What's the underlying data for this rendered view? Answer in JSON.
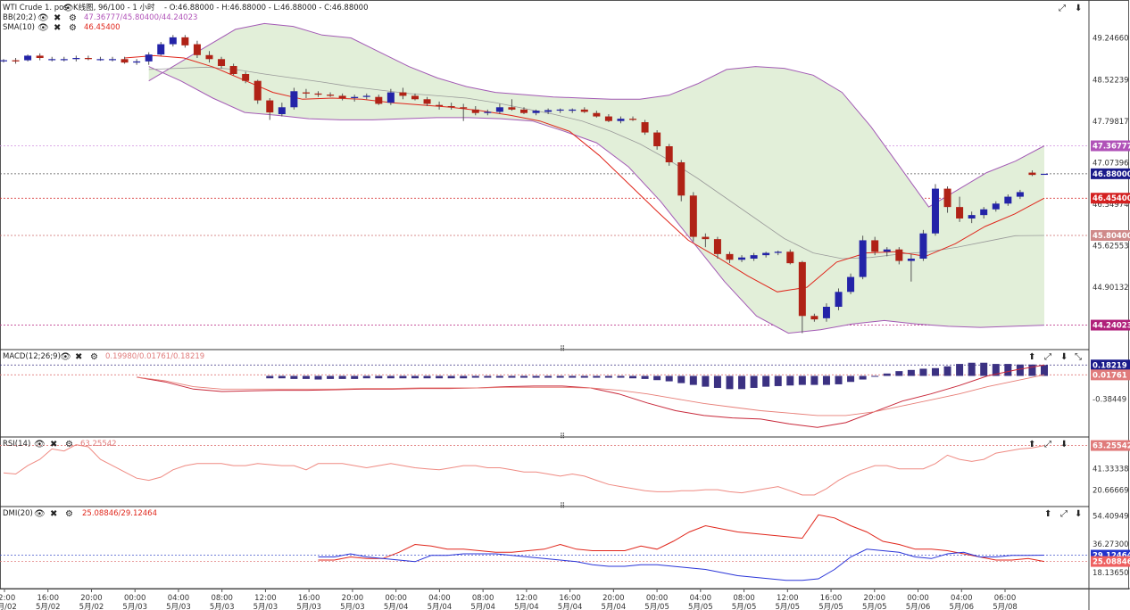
{
  "header": {
    "symbol": "WTI Crude 1. pos",
    "period": "K线图, 96/100 - 1 小时",
    "ohlc": "- O:46.88000 - H:46.88000 - L:46.88000 - C:46.88000"
  },
  "colors": {
    "up": "#2323a8",
    "down": "#b02216",
    "band_fill": "#e2efd9",
    "band_line": "#a35ab5",
    "mid_line": "#9a9a9a",
    "sma_line": "#e0261b",
    "macd_bar": "#3b3182",
    "macd_line": "#c8283a",
    "signal_line": "#e77d76",
    "rsi_line": "#ef8a82",
    "dmi_plus": "#e0261b",
    "dmi_minus": "#2a35d8",
    "tag_bb_upper": "#b052b8",
    "tag_last": "#1a1a8a",
    "tag_sma": "#d42020",
    "tag_bb_mid": "#cf8a8a",
    "tag_bb_lower": "#b0207a",
    "tag_macd": "#1a1a8a",
    "tag_signal": "#e07b7b",
    "tag_rsi": "#e07b7b",
    "tag_dmi_plus": "#ee6060",
    "tag_dmi_minus": "#2233cc"
  },
  "indicators": {
    "bb": {
      "name": "BB(20;2)",
      "value": "47.36777/45.80400/44.24023"
    },
    "sma": {
      "name": "SMA(10)",
      "value": "46.45400"
    },
    "macd": {
      "name": "MACD(12;26;9)",
      "value": "0.19980/0.01761/0.18219"
    },
    "rsi": {
      "name": "RSI(14)",
      "value": "63.25542"
    },
    "dmi": {
      "name": "DMI(20)",
      "value": "25.08846/29.12464"
    }
  },
  "price_axis": {
    "ticks": [
      "49.24660",
      "48.52239",
      "47.79817",
      "47.07396",
      "46.34974",
      "45.62553",
      "44.90132"
    ],
    "tags": {
      "bb_upper": "47.36777",
      "last": "46.88000",
      "sma": "46.45400",
      "bb_mid": "45.80400",
      "bb_lower": "44.24023"
    }
  },
  "macd_axis": {
    "ticks": [
      "-0.38449"
    ],
    "tags": {
      "macd": "0.18219",
      "signal": "0.01761"
    }
  },
  "rsi_axis": {
    "ticks": [
      "41.33338",
      "20.66669"
    ],
    "tags": {
      "rsi": "63.25542"
    }
  },
  "dmi_axis": {
    "ticks": [
      "54.40949",
      "36.27300",
      "18.13650"
    ],
    "tags": {
      "plus": "25.08846",
      "minus": "29.12464"
    }
  },
  "time_axis": [
    [
      "12:00",
      "5月/02"
    ],
    [
      "16:00",
      "5月/02"
    ],
    [
      "20:00",
      "5月/02"
    ],
    [
      "00:00",
      "5月/03"
    ],
    [
      "04:00",
      "5月/03"
    ],
    [
      "08:00",
      "5月/03"
    ],
    [
      "12:00",
      "5月/03"
    ],
    [
      "16:00",
      "5月/03"
    ],
    [
      "20:00",
      "5月/03"
    ],
    [
      "00:00",
      "5月/04"
    ],
    [
      "04:00",
      "5月/04"
    ],
    [
      "08:00",
      "5月/04"
    ],
    [
      "12:00",
      "5月/04"
    ],
    [
      "16:00",
      "5月/04"
    ],
    [
      "20:00",
      "5月/04"
    ],
    [
      "00:00",
      "5月/05"
    ],
    [
      "04:00",
      "5月/05"
    ],
    [
      "08:00",
      "5月/05"
    ],
    [
      "12:00",
      "5月/05"
    ],
    [
      "16:00",
      "5月/05"
    ],
    [
      "20:00",
      "5月/05"
    ],
    [
      "00:00",
      "5月/06"
    ],
    [
      "04:00",
      "5月/06"
    ],
    [
      "06:00",
      "5月/08"
    ]
  ],
  "chart_data": {
    "type": "candlestick",
    "title": "WTI Crude 1. pos",
    "interval": "1 hour",
    "ylim": [
      44.0,
      49.6
    ],
    "candles": [
      [
        48.85,
        48.88,
        48.82,
        48.86
      ],
      [
        48.86,
        48.9,
        48.8,
        48.84
      ],
      [
        48.86,
        48.96,
        48.84,
        48.94
      ],
      [
        48.94,
        48.98,
        48.86,
        48.9
      ],
      [
        48.88,
        48.92,
        48.84,
        48.88
      ],
      [
        48.88,
        48.92,
        48.84,
        48.88
      ],
      [
        48.88,
        48.94,
        48.84,
        48.9
      ],
      [
        48.9,
        48.94,
        48.86,
        48.88
      ],
      [
        48.88,
        48.92,
        48.85,
        48.88
      ],
      [
        48.88,
        48.92,
        48.84,
        48.88
      ],
      [
        48.88,
        48.92,
        48.8,
        48.82
      ],
      [
        48.82,
        48.88,
        48.78,
        48.84
      ],
      [
        48.84,
        49.0,
        48.78,
        48.96
      ],
      [
        48.96,
        49.18,
        48.94,
        49.14
      ],
      [
        49.14,
        49.3,
        49.1,
        49.26
      ],
      [
        49.26,
        49.3,
        49.08,
        49.12
      ],
      [
        49.14,
        49.2,
        48.9,
        48.95
      ],
      [
        48.95,
        49.02,
        48.82,
        48.88
      ],
      [
        48.88,
        48.92,
        48.72,
        48.76
      ],
      [
        48.76,
        48.8,
        48.6,
        48.62
      ],
      [
        48.62,
        48.66,
        48.46,
        48.5
      ],
      [
        48.5,
        48.52,
        48.1,
        48.16
      ],
      [
        48.16,
        48.2,
        47.82,
        47.95
      ],
      [
        47.92,
        48.12,
        47.88,
        48.04
      ],
      [
        48.04,
        48.38,
        48.0,
        48.32
      ],
      [
        48.3,
        48.36,
        48.2,
        48.28
      ],
      [
        48.28,
        48.32,
        48.22,
        48.26
      ],
      [
        48.26,
        48.3,
        48.22,
        48.24
      ],
      [
        48.24,
        48.28,
        48.16,
        48.2
      ],
      [
        48.2,
        48.26,
        48.14,
        48.22
      ],
      [
        48.22,
        48.28,
        48.18,
        48.24
      ],
      [
        48.22,
        48.26,
        48.08,
        48.1
      ],
      [
        48.12,
        48.36,
        48.08,
        48.3
      ],
      [
        48.3,
        48.38,
        48.18,
        48.24
      ],
      [
        48.24,
        48.28,
        48.16,
        48.18
      ],
      [
        48.18,
        48.22,
        48.06,
        48.1
      ],
      [
        48.08,
        48.14,
        48.0,
        48.06
      ],
      [
        48.06,
        48.12,
        48.0,
        48.04
      ],
      [
        48.04,
        48.1,
        47.8,
        48.02
      ],
      [
        48.0,
        48.06,
        47.9,
        47.94
      ],
      [
        47.94,
        48.0,
        47.9,
        47.96
      ],
      [
        47.96,
        48.1,
        47.92,
        48.04
      ],
      [
        48.04,
        48.18,
        47.98,
        48.0
      ],
      [
        48.0,
        48.04,
        47.92,
        47.94
      ],
      [
        47.94,
        48.0,
        47.9,
        47.98
      ],
      [
        47.96,
        48.02,
        47.92,
        47.99
      ],
      [
        47.99,
        48.02,
        47.94,
        48.0
      ],
      [
        47.98,
        48.02,
        47.94,
        48.0
      ],
      [
        48.0,
        48.04,
        47.94,
        47.96
      ],
      [
        47.94,
        47.98,
        47.86,
        47.88
      ],
      [
        47.88,
        47.92,
        47.78,
        47.8
      ],
      [
        47.8,
        47.88,
        47.76,
        47.84
      ],
      [
        47.84,
        47.88,
        47.8,
        47.82
      ],
      [
        47.78,
        47.82,
        47.56,
        47.6
      ],
      [
        47.6,
        47.64,
        47.3,
        47.36
      ],
      [
        47.36,
        47.4,
        47.02,
        47.08
      ],
      [
        47.08,
        47.12,
        46.4,
        46.5
      ],
      [
        46.5,
        46.56,
        45.7,
        45.78
      ],
      [
        45.78,
        45.84,
        45.6,
        45.74
      ],
      [
        45.74,
        45.78,
        45.4,
        45.48
      ],
      [
        45.48,
        45.52,
        45.32,
        45.38
      ],
      [
        45.38,
        45.46,
        45.34,
        45.42
      ],
      [
        45.4,
        45.5,
        45.36,
        45.46
      ],
      [
        45.46,
        45.52,
        45.42,
        45.5
      ],
      [
        45.5,
        45.54,
        45.46,
        45.52
      ],
      [
        45.52,
        45.56,
        45.3,
        45.32
      ],
      [
        45.34,
        45.36,
        44.1,
        44.4
      ],
      [
        44.4,
        44.44,
        44.3,
        44.34
      ],
      [
        44.36,
        44.62,
        44.3,
        44.56
      ],
      [
        44.56,
        44.88,
        44.5,
        44.82
      ],
      [
        44.82,
        45.14,
        44.78,
        45.08
      ],
      [
        45.08,
        45.8,
        45.04,
        45.72
      ],
      [
        45.72,
        45.78,
        45.46,
        45.52
      ],
      [
        45.52,
        45.6,
        45.44,
        45.56
      ],
      [
        45.56,
        45.6,
        45.3,
        45.36
      ],
      [
        45.36,
        45.48,
        45.0,
        45.4
      ],
      [
        45.4,
        45.9,
        45.36,
        45.84
      ],
      [
        45.84,
        46.7,
        45.8,
        46.62
      ],
      [
        46.62,
        46.66,
        46.2,
        46.3
      ],
      [
        46.3,
        46.48,
        46.04,
        46.1
      ],
      [
        46.1,
        46.22,
        46.02,
        46.16
      ],
      [
        46.16,
        46.3,
        46.1,
        46.26
      ],
      [
        46.26,
        46.4,
        46.22,
        46.36
      ],
      [
        46.36,
        46.52,
        46.32,
        46.48
      ],
      [
        46.48,
        46.6,
        46.44,
        46.56
      ],
      [
        46.9,
        46.94,
        46.84,
        46.86
      ],
      [
        46.88,
        46.88,
        46.88,
        46.88
      ]
    ],
    "bollinger": {
      "upper": [
        48.5,
        48.8,
        49.1,
        49.4,
        49.5,
        49.45,
        49.3,
        49.25,
        49.0,
        48.75,
        48.55,
        48.4,
        48.3,
        48.26,
        48.22,
        48.2,
        48.18,
        48.18,
        48.25,
        48.45,
        48.7,
        48.75,
        48.72,
        48.6,
        48.3,
        47.7,
        47.0,
        46.3,
        46.6,
        46.9,
        47.1,
        47.36777
      ],
      "mid": [
        48.7,
        48.72,
        48.74,
        48.7,
        48.62,
        48.55,
        48.48,
        48.4,
        48.34,
        48.28,
        48.24,
        48.2,
        48.12,
        48.02,
        47.92,
        47.8,
        47.62,
        47.4,
        47.12,
        46.8,
        46.45,
        46.1,
        45.75,
        45.5,
        45.4,
        45.42,
        45.48,
        45.52,
        45.6,
        45.7,
        45.8,
        45.804
      ],
      "lower": [
        48.75,
        48.5,
        48.2,
        47.95,
        47.9,
        47.84,
        47.82,
        47.82,
        47.84,
        47.86,
        47.86,
        47.84,
        47.8,
        47.62,
        47.42,
        47.0,
        46.4,
        45.7,
        45.0,
        44.4,
        44.1,
        44.16,
        44.26,
        44.32,
        44.26,
        44.22,
        44.2,
        44.22,
        44.24023
      ],
      "start_index": [
        12,
        12,
        12
      ]
    },
    "sma10": [
      48.9,
      48.94,
      48.9,
      48.74,
      48.52,
      48.3,
      48.18,
      48.2,
      48.18,
      48.12,
      48.08,
      48.04,
      47.98,
      47.9,
      47.8,
      47.62,
      47.2,
      46.7,
      46.2,
      45.72,
      45.42,
      45.1,
      44.82,
      44.9,
      45.34,
      45.5,
      45.52,
      45.44,
      45.66,
      45.96,
      46.18,
      46.454
    ],
    "macd": {
      "histogram": [
        -0.04,
        -0.04,
        -0.05,
        -0.05,
        -0.06,
        -0.05,
        -0.05,
        -0.05,
        -0.04,
        -0.04,
        -0.04,
        -0.04,
        -0.04,
        -0.04,
        -0.04,
        -0.04,
        -0.04,
        -0.03,
        -0.03,
        -0.03,
        -0.03,
        -0.03,
        -0.03,
        -0.03,
        -0.03,
        -0.03,
        -0.03,
        -0.03,
        -0.03,
        -0.03,
        -0.04,
        -0.05,
        -0.07,
        -0.09,
        -0.12,
        -0.15,
        -0.18,
        -0.2,
        -0.22,
        -0.22,
        -0.2,
        -0.18,
        -0.17,
        -0.16,
        -0.15,
        -0.15,
        -0.15,
        -0.14,
        -0.1,
        -0.06,
        -0.01,
        0.04,
        0.08,
        0.1,
        0.12,
        0.13,
        0.16,
        0.2,
        0.22,
        0.22,
        0.2,
        0.2,
        0.19,
        0.19,
        0.18219
      ],
      "macd_line": [
        -0.02,
        -0.1,
        -0.22,
        -0.26,
        -0.25,
        -0.24,
        -0.24,
        -0.23,
        -0.22,
        -0.22,
        -0.21,
        -0.21,
        -0.2,
        -0.18,
        -0.17,
        -0.17,
        -0.2,
        -0.3,
        -0.45,
        -0.58,
        -0.66,
        -0.7,
        -0.72,
        -0.8,
        -0.86,
        -0.78,
        -0.6,
        -0.42,
        -0.3,
        -0.16,
        0.0,
        0.1,
        0.18219
      ],
      "signal_line": [
        -0.02,
        -0.08,
        -0.18,
        -0.22,
        -0.22,
        -0.22,
        -0.22,
        -0.22,
        -0.21,
        -0.21,
        -0.2,
        -0.2,
        -0.2,
        -0.19,
        -0.19,
        -0.19,
        -0.2,
        -0.24,
        -0.3,
        -0.38,
        -0.46,
        -0.52,
        -0.58,
        -0.62,
        -0.66,
        -0.66,
        -0.6,
        -0.5,
        -0.4,
        -0.3,
        -0.18,
        -0.08,
        0.01761
      ]
    },
    "rsi": [
      37,
      36,
      44,
      50,
      60,
      58,
      64,
      62,
      50,
      44,
      38,
      32,
      30,
      33,
      40,
      44,
      46,
      46,
      46,
      44,
      44,
      46,
      45,
      44,
      44,
      40,
      46,
      46,
      46,
      44,
      42,
      44,
      46,
      44,
      42,
      41,
      40,
      42,
      44,
      44,
      42,
      42,
      40,
      38,
      38,
      36,
      34,
      36,
      34,
      30,
      26,
      24,
      22,
      20,
      19,
      19,
      20,
      20,
      21,
      21,
      19,
      18,
      20,
      22,
      24,
      20,
      16,
      16,
      22,
      30,
      36,
      40,
      44,
      44,
      41,
      41,
      41,
      46,
      54,
      50,
      48,
      50,
      56,
      58,
      60,
      61,
      63.25542
    ],
    "dmi": {
      "plus": [
        26,
        26,
        28,
        27,
        27,
        31,
        36,
        35,
        33,
        33,
        32,
        31,
        31,
        32,
        33,
        36,
        33,
        32,
        32,
        32,
        35,
        33,
        38,
        44,
        48,
        46,
        44,
        43,
        42,
        41,
        40,
        55,
        53,
        48,
        44,
        38,
        36,
        33,
        33,
        32,
        30,
        28,
        26,
        26,
        27,
        25.08846
      ],
      "minus": [
        28,
        28,
        30,
        28,
        27,
        26,
        25,
        29,
        29,
        30,
        30,
        30,
        29,
        28,
        27,
        26,
        25,
        23,
        22,
        22,
        23,
        23,
        22,
        21,
        20,
        18,
        16,
        15,
        14,
        13,
        13,
        14,
        20,
        28,
        33,
        32,
        31,
        28,
        27,
        30,
        31,
        28,
        28,
        29,
        29,
        29.12464
      ]
    }
  }
}
